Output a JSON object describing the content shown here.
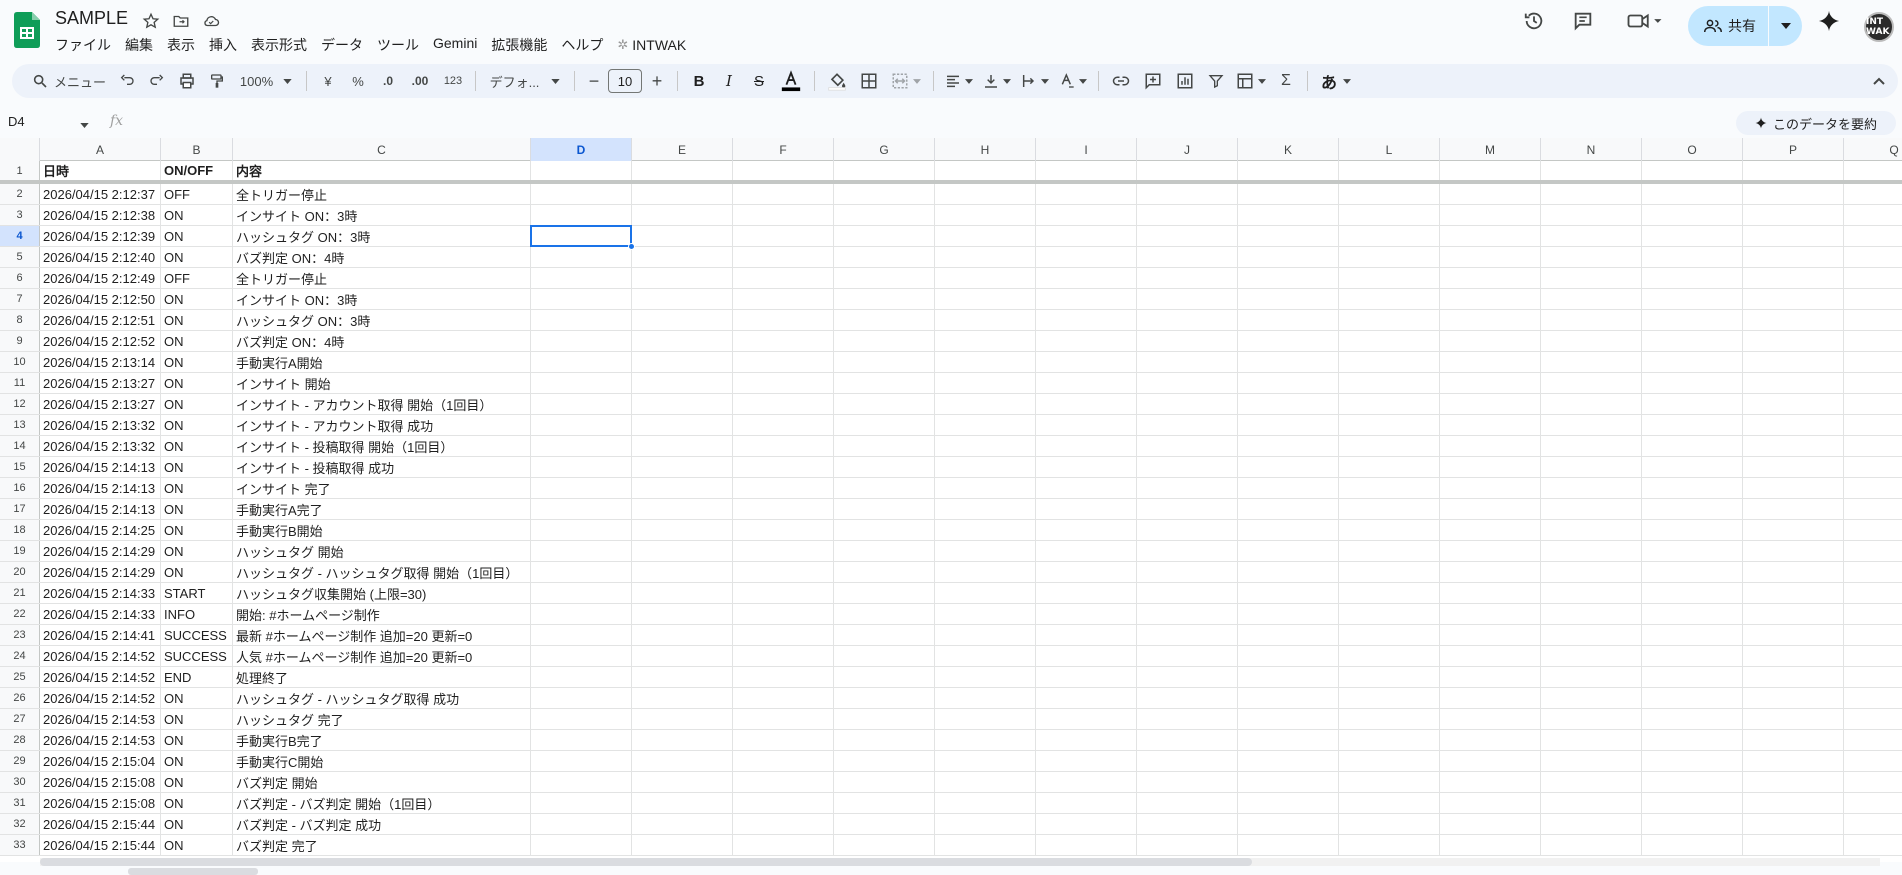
{
  "doc": {
    "title": "SAMPLE"
  },
  "menu": [
    "ファイル",
    "編集",
    "表示",
    "挿入",
    "表示形式",
    "データ",
    "ツール",
    "Gemini",
    "拡張機能",
    "ヘルプ",
    "INTWAK"
  ],
  "share": {
    "label": "共有",
    "color": "#c2e7ff"
  },
  "avatar": {
    "text": "INT WAK"
  },
  "toolbar": {
    "menu_search": "メニュー",
    "zoom": "100%",
    "currency": "¥",
    "percent": "%",
    "dec_decrease": ".0",
    "dec_increase": ".00",
    "number_format": "123",
    "font": "デフォ...",
    "font_size": "10",
    "input_tool": "あ"
  },
  "formula_bar": {
    "name_box": "D4",
    "fx": "fx",
    "summary": "このデータを要約"
  },
  "grid": {
    "columns": [
      "A",
      "B",
      "C",
      "D",
      "E",
      "F",
      "G",
      "H",
      "I",
      "J",
      "K",
      "L",
      "M",
      "N",
      "O",
      "P",
      "Q"
    ],
    "selected_column": "D",
    "selected_row": "4",
    "headers": [
      "日時",
      "ON/OFF",
      "内容"
    ],
    "rows": [
      [
        "2026/04/15 2:12:37",
        "OFF",
        "全トリガー停止"
      ],
      [
        "2026/04/15 2:12:38",
        "ON",
        "インサイト ON：3時"
      ],
      [
        "2026/04/15 2:12:39",
        "ON",
        "ハッシュタグ ON：3時"
      ],
      [
        "2026/04/15 2:12:40",
        "ON",
        "バズ判定 ON：4時"
      ],
      [
        "2026/04/15 2:12:49",
        "OFF",
        "全トリガー停止"
      ],
      [
        "2026/04/15 2:12:50",
        "ON",
        "インサイト ON：3時"
      ],
      [
        "2026/04/15 2:12:51",
        "ON",
        "ハッシュタグ ON：3時"
      ],
      [
        "2026/04/15 2:12:52",
        "ON",
        "バズ判定 ON：4時"
      ],
      [
        "2026/04/15 2:13:14",
        "ON",
        "手動実行A開始"
      ],
      [
        "2026/04/15 2:13:27",
        "ON",
        "インサイト 開始"
      ],
      [
        "2026/04/15 2:13:27",
        "ON",
        "インサイト - アカウント取得 開始（1回目）"
      ],
      [
        "2026/04/15 2:13:32",
        "ON",
        "インサイト - アカウント取得 成功"
      ],
      [
        "2026/04/15 2:13:32",
        "ON",
        "インサイト - 投稿取得 開始（1回目）"
      ],
      [
        "2026/04/15 2:14:13",
        "ON",
        "インサイト - 投稿取得 成功"
      ],
      [
        "2026/04/15 2:14:13",
        "ON",
        "インサイト 完了"
      ],
      [
        "2026/04/15 2:14:13",
        "ON",
        "手動実行A完了"
      ],
      [
        "2026/04/15 2:14:25",
        "ON",
        "手動実行B開始"
      ],
      [
        "2026/04/15 2:14:29",
        "ON",
        "ハッシュタグ 開始"
      ],
      [
        "2026/04/15 2:14:29",
        "ON",
        "ハッシュタグ - ハッシュタグ取得 開始（1回目）"
      ],
      [
        "2026/04/15 2:14:33",
        "START",
        "ハッシュタグ収集開始 (上限=30)"
      ],
      [
        "2026/04/15 2:14:33",
        "INFO",
        "開始: #ホームページ制作"
      ],
      [
        "2026/04/15 2:14:41",
        "SUCCESS",
        "最新 #ホームページ制作 追加=20 更新=0"
      ],
      [
        "2026/04/15 2:14:52",
        "SUCCESS",
        "人気 #ホームページ制作 追加=20 更新=0"
      ],
      [
        "2026/04/15 2:14:52",
        "END",
        "処理終了"
      ],
      [
        "2026/04/15 2:14:52",
        "ON",
        "ハッシュタグ - ハッシュタグ取得 成功"
      ],
      [
        "2026/04/15 2:14:53",
        "ON",
        "ハッシュタグ 完了"
      ],
      [
        "2026/04/15 2:14:53",
        "ON",
        "手動実行B完了"
      ],
      [
        "2026/04/15 2:15:04",
        "ON",
        "手動実行C開始"
      ],
      [
        "2026/04/15 2:15:08",
        "ON",
        "バズ判定 開始"
      ],
      [
        "2026/04/15 2:15:08",
        "ON",
        "バズ判定 - バズ判定 開始（1回目）"
      ],
      [
        "2026/04/15 2:15:44",
        "ON",
        "バズ判定 - バズ判定 成功"
      ],
      [
        "2026/04/15 2:15:44",
        "ON",
        "バズ判定 完了"
      ]
    ]
  },
  "colors": {
    "accent": "#1a73e8",
    "sheets_green": "#0f9d58"
  }
}
